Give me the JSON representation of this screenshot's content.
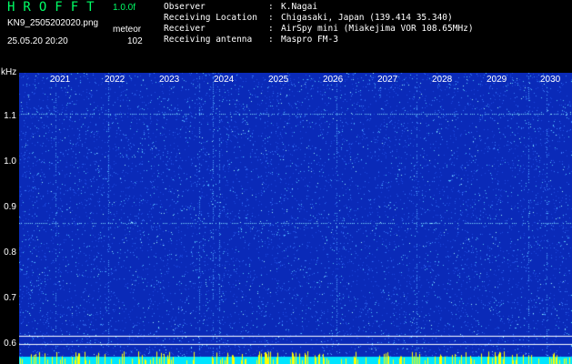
{
  "header": {
    "app_title": "HROFFT",
    "version": "1.0.0f",
    "filename": "KN9_2505202020.png",
    "datetime": "25.05.20 20:20",
    "meteor_label": "meteor",
    "meteor_count": "102"
  },
  "info": [
    {
      "key": "Observer",
      "sep": ":",
      "value": "K.Nagai"
    },
    {
      "key": "Receiving Location",
      "sep": ":",
      "value": "Chigasaki, Japan (139.414 35.340)"
    },
    {
      "key": "Receiver",
      "sep": ":",
      "value": "AirSpy mini (Miakejima VOR 108.65MHz)"
    },
    {
      "key": "Receiving antenna",
      "sep": ":",
      "value": "Maspro FM-3"
    }
  ],
  "axis": {
    "unit": "kHz",
    "y_ticks": [
      "1.1",
      "1.0",
      "0.9",
      "0.8",
      "0.7",
      "0.6"
    ],
    "x_ticks": [
      "2021",
      "2022",
      "2023",
      "2024",
      "2025",
      "2026",
      "2027",
      "2028",
      "2029",
      "2030"
    ]
  },
  "colors": {
    "background": "#000000",
    "waterfall": "#0a2ab8",
    "title": "#00ff66",
    "signal": "#00ffff",
    "baseline": "#ffff00"
  }
}
